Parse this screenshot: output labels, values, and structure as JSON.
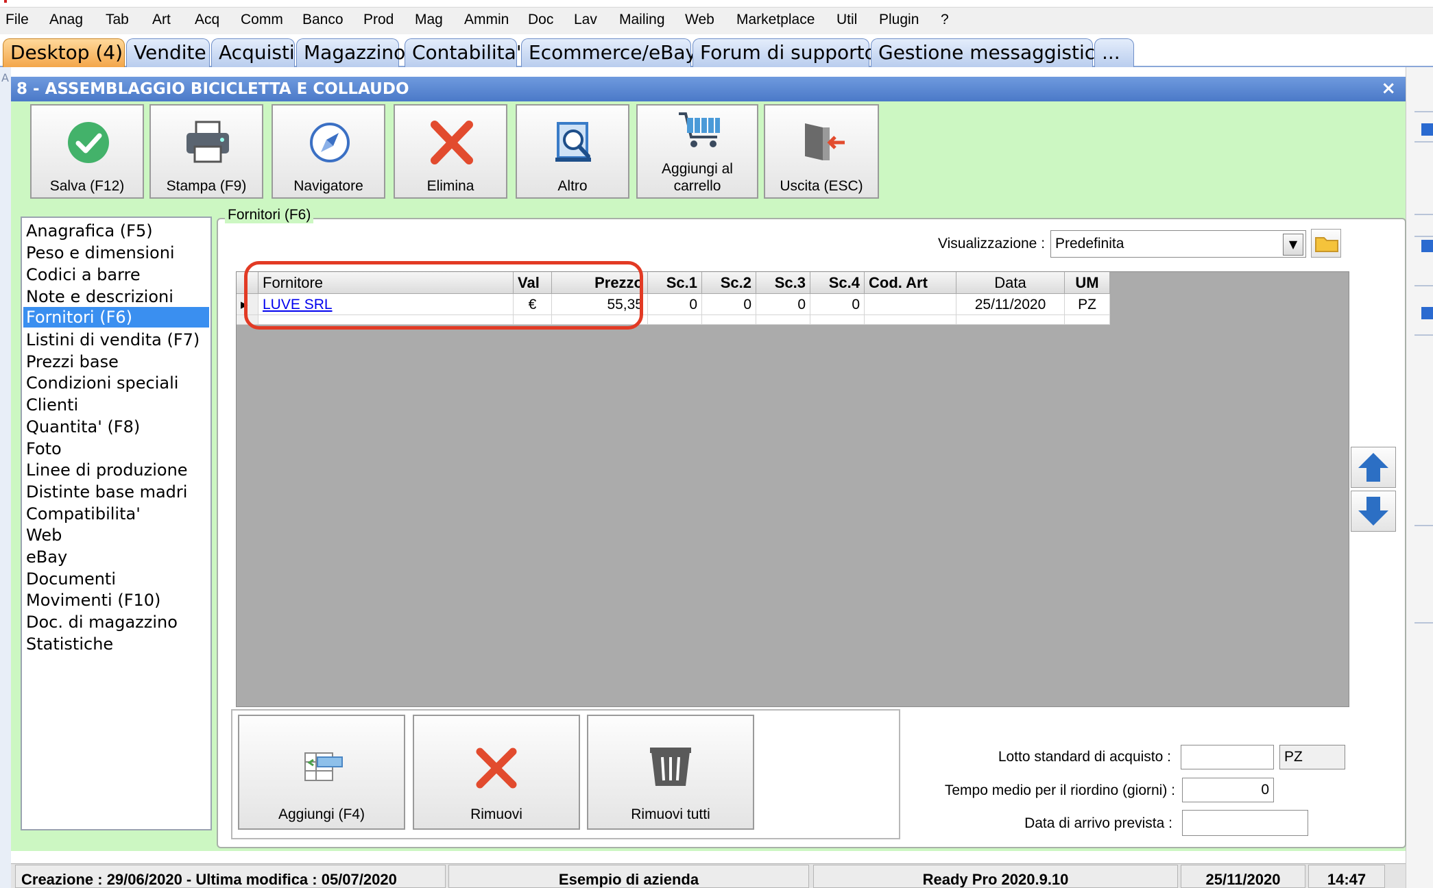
{
  "menu": [
    "File",
    "Anag",
    "Tab",
    "Art",
    "Acq",
    "Comm",
    "Banco",
    "Prod",
    "Mag",
    "Ammin",
    "Doc",
    "Lav",
    "Mailing",
    "Web",
    "Marketplace",
    "Util",
    "Plugin",
    "?"
  ],
  "tabs": [
    "Desktop (4)",
    "Vendite",
    "Acquisti",
    "Magazzino",
    "Contabilita'",
    "Ecommerce/eBay",
    "Forum di supporto",
    "Gestione messaggistica",
    "..."
  ],
  "window": {
    "title": "8 - ASSEMBLAGGIO BICICLETTA E COLLAUDO",
    "close": "×"
  },
  "toolbar": [
    {
      "label": "Salva (F12)",
      "icon": "check-icon"
    },
    {
      "label": "Stampa (F9)",
      "icon": "printer-icon"
    },
    {
      "label": "Navigatore",
      "icon": "compass-icon"
    },
    {
      "label": "Elimina",
      "icon": "delete-x-icon"
    },
    {
      "label": "Altro",
      "icon": "search-book-icon"
    },
    {
      "label": "Aggiungi al carrello",
      "icon": "cart-icon"
    },
    {
      "label": "Uscita (ESC)",
      "icon": "exit-door-icon"
    }
  ],
  "nav": {
    "selected": 4,
    "items": [
      "Anagrafica (F5)",
      "Peso e dimensioni",
      "Codici a barre",
      "Note e descrizioni",
      "Fornitori (F6)",
      "Listini di vendita (F7)",
      "Prezzi base",
      "Condizioni speciali",
      "Clienti",
      "Quantita' (F8)",
      "Foto",
      "Linee di produzione",
      "Distinte base madri",
      "Compatibilita'",
      "Web",
      "eBay",
      "Documenti",
      "Movimenti (F10)",
      "Doc. di magazzino",
      "Statistiche"
    ]
  },
  "group_title": "Fornitori (F6)",
  "visualizzazione": {
    "label": "Visualizzazione :",
    "value": "Predefinita"
  },
  "grid": {
    "columns": [
      "Fornitore",
      "Val",
      "Prezzo",
      "Sc.1",
      "Sc.2",
      "Sc.3",
      "Sc.4",
      "Cod. Art",
      "Data",
      "UM"
    ],
    "rows": [
      {
        "fornitore": "LUVE SRL",
        "val": "€",
        "prezzo": "55,35",
        "sc1": "0",
        "sc2": "0",
        "sc3": "0",
        "sc4": "0",
        "cod_art": "",
        "data": "25/11/2020",
        "um": "PZ"
      }
    ]
  },
  "bottom_buttons": [
    {
      "label": "Aggiungi (F4)",
      "icon": "add-row-icon"
    },
    {
      "label": "Rimuovi",
      "icon": "remove-x-icon"
    },
    {
      "label": "Rimuovi tutti",
      "icon": "trash-icon"
    }
  ],
  "fields": {
    "lotto_label": "Lotto standard di acquisto :",
    "lotto_value": "",
    "lotto_um": "PZ",
    "tempo_label": "Tempo medio per il riordino (giorni) :",
    "tempo_value": "0",
    "arrivo_label": "Data di arrivo prevista :",
    "arrivo_value": ""
  },
  "status": {
    "created": "Creazione : 29/06/2020 - Ultima modifica : 05/07/2020",
    "company": "Esempio di azienda",
    "version": "Ready Pro 2020.9.10",
    "date": "25/11/2020",
    "time": "14:47"
  },
  "colors": {
    "highlight": "#e23a24",
    "selection": "#3a8ff0",
    "client_bg": "#ccf7c2",
    "title_bar": "#5585d0"
  }
}
